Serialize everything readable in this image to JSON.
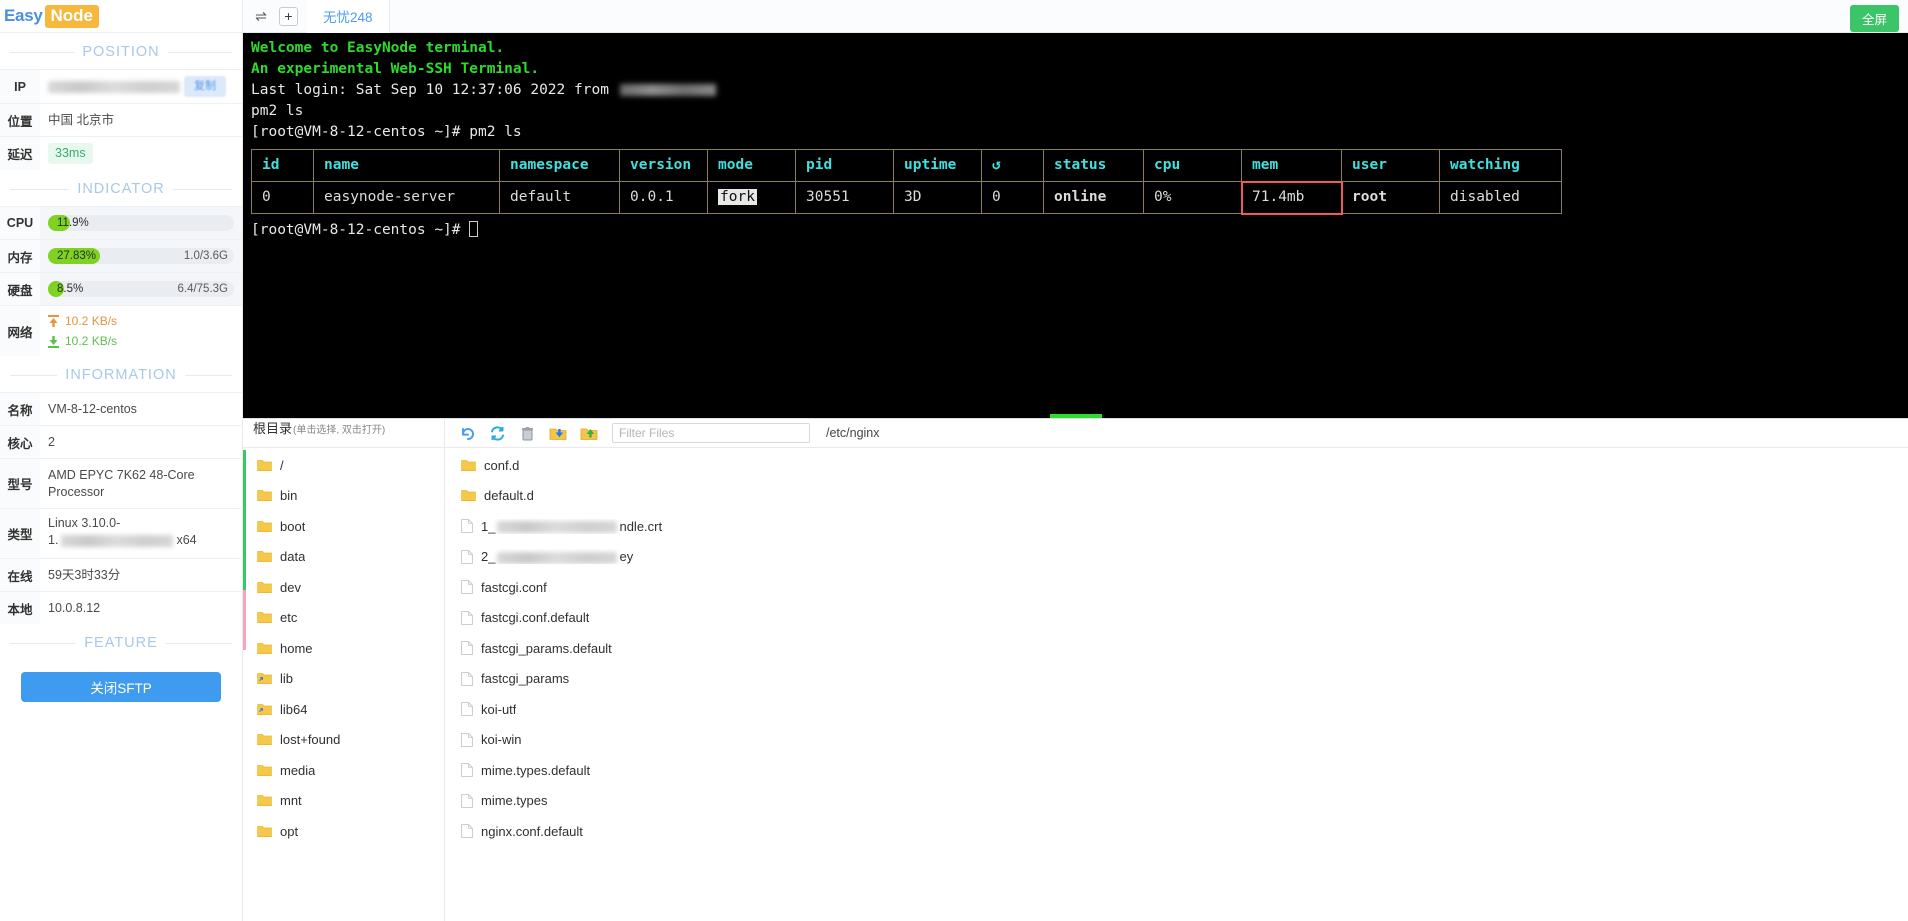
{
  "brand": {
    "easy": "Easy",
    "node": "Node"
  },
  "sidebar": {
    "position": {
      "title": "POSITION",
      "rows": [
        {
          "key": "IP",
          "value": "",
          "redacted": true,
          "copy_label": "复制"
        },
        {
          "key": "位置",
          "value": "中国 北京市"
        },
        {
          "key": "延迟",
          "value": "33ms"
        }
      ]
    },
    "indicator": {
      "title": "INDICATOR",
      "cpu": {
        "key": "CPU",
        "percent_label": "11.9%",
        "percent": 11.9,
        "right": ""
      },
      "mem": {
        "key": "内存",
        "percent_label": "27.83%",
        "percent": 27.83,
        "right": "1.0/3.6G"
      },
      "disk": {
        "key": "硬盘",
        "percent_label": "8.5%",
        "percent": 8.5,
        "right": "6.4/75.3G"
      },
      "net": {
        "key": "网络",
        "up": "10.2 KB/s",
        "down": "10.2 KB/s"
      }
    },
    "information": {
      "title": "INFORMATION",
      "rows": [
        {
          "key": "名称",
          "value": "VM-8-12-centos"
        },
        {
          "key": "核心",
          "value": "2"
        },
        {
          "key": "型号",
          "value": "AMD EPYC 7K62 48-Core Processor"
        },
        {
          "key": "类型",
          "value_prefix": "Linux 3.10.0-",
          "value_suffix": "x64",
          "redacted": true
        },
        {
          "key": "在线",
          "value": "59天3时33分"
        },
        {
          "key": "本地",
          "value": "10.0.8.12"
        }
      ]
    },
    "feature": {
      "title": "FEATURE",
      "sftp_button": "关闭SFTP"
    }
  },
  "tabbar": {
    "swap_icon": "swap-icon",
    "add_label": "+",
    "tabs": [
      {
        "label": "无忧248",
        "active": true
      }
    ],
    "fullscreen_label": "全屏"
  },
  "terminal": {
    "lines": [
      {
        "text": "Welcome to EasyNode terminal.",
        "style": "green"
      },
      {
        "text": "An experimental Web-SSH Terminal.",
        "style": "green"
      },
      {
        "text": "Last login: Sat Sep 10 12:37:06 2022 from ",
        "style": "white",
        "redacted_tail": true
      },
      {
        "text": "pm2 ls",
        "style": "white"
      },
      {
        "text": "[root@VM-8-12-centos ~]# pm2 ls",
        "style": "white"
      }
    ],
    "prompt": "[root@VM-8-12-centos ~]# ",
    "pm2_table": {
      "headers": [
        "id",
        "name",
        "namespace",
        "version",
        "mode",
        "pid",
        "uptime",
        "↺",
        "status",
        "cpu",
        "mem",
        "user",
        "watching"
      ],
      "rows": [
        {
          "id": "0",
          "name": "easynode-server",
          "namespace": "default",
          "version": "0.0.1",
          "mode": "fork",
          "pid": "30551",
          "uptime": "3D",
          "restarts": "0",
          "status": "online",
          "cpu": "0%",
          "mem": "71.4mb",
          "user": "root",
          "watching": "disabled"
        }
      ],
      "highlight_cell": "mem",
      "highlight_color": "#f05a5a"
    }
  },
  "sftp": {
    "root_label_main": "根目录",
    "root_label_hint": "(单击选择, 双击打开)",
    "toolbar_icons": [
      "undo-icon",
      "refresh-icon",
      "delete-icon",
      "download-icon",
      "upload-icon"
    ],
    "filter_placeholder": "Filter Files",
    "current_path": "/etc/nginx",
    "dirtree": [
      {
        "name": "/",
        "type": "folder"
      },
      {
        "name": "bin",
        "type": "folder"
      },
      {
        "name": "boot",
        "type": "folder"
      },
      {
        "name": "data",
        "type": "folder"
      },
      {
        "name": "dev",
        "type": "folder"
      },
      {
        "name": "etc",
        "type": "folder"
      },
      {
        "name": "home",
        "type": "folder"
      },
      {
        "name": "lib",
        "type": "folder-link"
      },
      {
        "name": "lib64",
        "type": "folder-link"
      },
      {
        "name": "lost+found",
        "type": "folder"
      },
      {
        "name": "media",
        "type": "folder"
      },
      {
        "name": "mnt",
        "type": "folder"
      },
      {
        "name": "opt",
        "type": "folder"
      }
    ],
    "files": [
      {
        "name": "conf.d",
        "type": "folder"
      },
      {
        "name": "default.d",
        "type": "folder"
      },
      {
        "name": "1_",
        "type": "file",
        "redacted": true,
        "suffix": "ndle.crt"
      },
      {
        "name": "2_",
        "type": "file",
        "redacted": true,
        "suffix": "ey"
      },
      {
        "name": "fastcgi.conf",
        "type": "file"
      },
      {
        "name": "fastcgi.conf.default",
        "type": "file"
      },
      {
        "name": "fastcgi_params.default",
        "type": "file"
      },
      {
        "name": "fastcgi_params",
        "type": "file"
      },
      {
        "name": "koi-utf",
        "type": "file"
      },
      {
        "name": "koi-win",
        "type": "file"
      },
      {
        "name": "mime.types.default",
        "type": "file"
      },
      {
        "name": "mime.types",
        "type": "file"
      },
      {
        "name": "nginx.conf.default",
        "type": "file"
      }
    ]
  },
  "colors": {
    "brand_blue": "#4a8fe0",
    "brand_orange": "#f6b73c",
    "accent_blue": "#3e9bf0",
    "green": "#7ed321",
    "terminal_green": "#2cdb2c",
    "terminal_cyan": "#3fe0e0",
    "highlight_red": "#f05a5a",
    "fullscreen_green": "#3bc468"
  }
}
